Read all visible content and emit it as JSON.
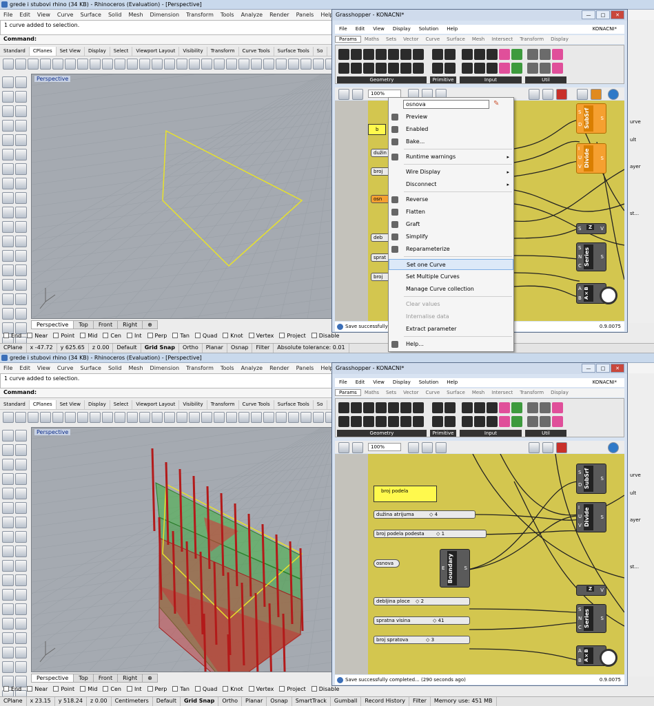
{
  "top": {
    "title": "grede i stubovi rhino (34 KB) - Rhinoceros (Evaluation) - [Perspective]",
    "menu": [
      "File",
      "Edit",
      "View",
      "Curve",
      "Surface",
      "Solid",
      "Mesh",
      "Dimension",
      "Transform",
      "Tools",
      "Analyze",
      "Render",
      "Panels",
      "Help"
    ],
    "history": "1 curve added to selection.",
    "command_label": "Command:",
    "tabs": [
      "Standard",
      "CPlanes",
      "Set View",
      "Display",
      "Select",
      "Viewport Layout",
      "Visibility",
      "Transform",
      "Curve Tools",
      "Surface Tools",
      "So"
    ],
    "active_tab": "CPlanes",
    "viewport_title": "Perspective",
    "view_tabs": [
      "Perspective",
      "Top",
      "Front",
      "Right"
    ],
    "osnaps": [
      "End",
      "Near",
      "Point",
      "Mid",
      "Cen",
      "Int",
      "Perp",
      "Tan",
      "Quad",
      "Knot",
      "Vertex",
      "Project",
      "Disable"
    ],
    "status": {
      "cplane": "CPlane",
      "x": "x -47.72",
      "y": "y 625.65",
      "z": "z 0.00",
      "default": "Default",
      "gridsnap": "Grid Snap",
      "ortho": "Ortho",
      "planar": "Planar",
      "osnap": "Osnap",
      "filter": "Filter",
      "tolerance": "Absolute tolerance: 0.01"
    },
    "gh": {
      "title": "Grasshopper - KONACNI*",
      "menu": [
        "File",
        "Edit",
        "View",
        "Display",
        "Solution",
        "Help"
      ],
      "doc": "KONACNI*",
      "tabs": [
        "Params",
        "Maths",
        "Sets",
        "Vector",
        "Curve",
        "Surface",
        "Mesh",
        "Intersect",
        "Transform",
        "Display"
      ],
      "groups": [
        "Geometry",
        "Primitive",
        "Input",
        "Util"
      ],
      "zoom": "100%",
      "status": "Save successfully",
      "version": "0.9.0075",
      "nodes": {
        "subsrf": "SubSrf",
        "divide": "Divide",
        "series": "Series",
        "axb": "A×B",
        "z": "Z",
        "in_s": "S",
        "in_d": "D",
        "in_i": "I",
        "in_u": "U",
        "in_v": "V",
        "in_n": "N",
        "in_c": "C",
        "in_a": "A",
        "in_b": "B",
        "out_s": "S",
        "out_v": "V",
        "out_r": "R"
      },
      "left_params": [
        "b",
        "dužin",
        "broj",
        "osn",
        "deb",
        "sprat",
        "broj"
      ],
      "side": [
        "urve",
        "ult",
        "ayer",
        "st..."
      ]
    },
    "context": {
      "search": "osnova",
      "items": [
        {
          "label": "Preview",
          "arrow": ""
        },
        {
          "label": "Enabled",
          "arrow": ""
        },
        {
          "label": "Bake...",
          "arrow": ""
        },
        {
          "label": "Runtime warnings",
          "arrow": "▸"
        },
        {
          "label": "Wire Display",
          "arrow": "▸"
        },
        {
          "label": "Disconnect",
          "arrow": "▸"
        },
        {
          "label": "Reverse",
          "arrow": ""
        },
        {
          "label": "Flatten",
          "arrow": ""
        },
        {
          "label": "Graft",
          "arrow": ""
        },
        {
          "label": "Simplify",
          "arrow": ""
        },
        {
          "label": "Reparameterize",
          "arrow": ""
        },
        {
          "label": "Set one Curve",
          "arrow": ""
        },
        {
          "label": "Set Multiple Curves",
          "arrow": ""
        },
        {
          "label": "Manage Curve collection",
          "arrow": ""
        },
        {
          "label": "Clear values",
          "arrow": ""
        },
        {
          "label": "Internalise data",
          "arrow": ""
        },
        {
          "label": "Extract parameter",
          "arrow": ""
        },
        {
          "label": "Help...",
          "arrow": ""
        }
      ]
    }
  },
  "bottom": {
    "title": "grede i stubovi rhino (34 KB) - Rhinoceros (Evaluation) - [Perspective]",
    "menu": [
      "File",
      "Edit",
      "View",
      "Curve",
      "Surface",
      "Solid",
      "Mesh",
      "Dimension",
      "Transform",
      "Tools",
      "Analyze",
      "Render",
      "Panels",
      "Help"
    ],
    "history": "1 curve added to selection.",
    "command_label": "Command:",
    "tabs": [
      "Standard",
      "CPlanes",
      "Set View",
      "Display",
      "Select",
      "Viewport Layout",
      "Visibility",
      "Transform",
      "Curve Tools",
      "Surface Tools",
      "So"
    ],
    "viewport_title": "Perspective",
    "view_tabs": [
      "Perspective",
      "Top",
      "Front",
      "Right"
    ],
    "osnaps": [
      "End",
      "Near",
      "Point",
      "Mid",
      "Cen",
      "Int",
      "Perp",
      "Tan",
      "Quad",
      "Knot",
      "Vertex",
      "Project",
      "Disable"
    ],
    "status": {
      "cplane": "CPlane",
      "x": "x 23.15",
      "y": "y 518.24",
      "z": "z 0.00",
      "units": "Centimeters",
      "default": "Default",
      "gridsnap": "Grid Snap",
      "ortho": "Ortho",
      "planar": "Planar",
      "osnap": "Osnap",
      "smarttrack": "SmartTrack",
      "gumball": "Gumball",
      "history": "Record History",
      "filter": "Filter",
      "memory": "Memory use: 451 MB"
    },
    "gh": {
      "title": "Grasshopper - KONACNI*",
      "menu": [
        "File",
        "Edit",
        "View",
        "Display",
        "Solution",
        "Help"
      ],
      "doc": "KONACNI*",
      "tabs": [
        "Params",
        "Maths",
        "Sets",
        "Vector",
        "Curve",
        "Surface",
        "Mesh",
        "Intersect",
        "Transform",
        "Display"
      ],
      "groups": [
        "Geometry",
        "Primitive",
        "Input",
        "Util"
      ],
      "zoom": "100%",
      "status": "Save successfully completed... (290 seconds ago)",
      "version": "0.9.0075",
      "panel": "broj podela",
      "sliders": [
        {
          "label": "dužina atrijuma",
          "value": "◇ 4"
        },
        {
          "label": "broj podela podesta",
          "value": "◇ 1"
        },
        {
          "label": "debljina ploce",
          "value": "◇ 2"
        },
        {
          "label": "spratna visina",
          "value": "◇ 41"
        },
        {
          "label": "broj spratova",
          "value": "◇ 3"
        }
      ],
      "osnova": "osnova",
      "nodes": {
        "boundary": "Boundary",
        "subsrf": "SubSrf",
        "divide": "Divide",
        "series": "Series",
        "axb": "A×B",
        "z": "Z"
      },
      "side": [
        "urve",
        "ult",
        "ayer",
        "st..."
      ]
    }
  }
}
